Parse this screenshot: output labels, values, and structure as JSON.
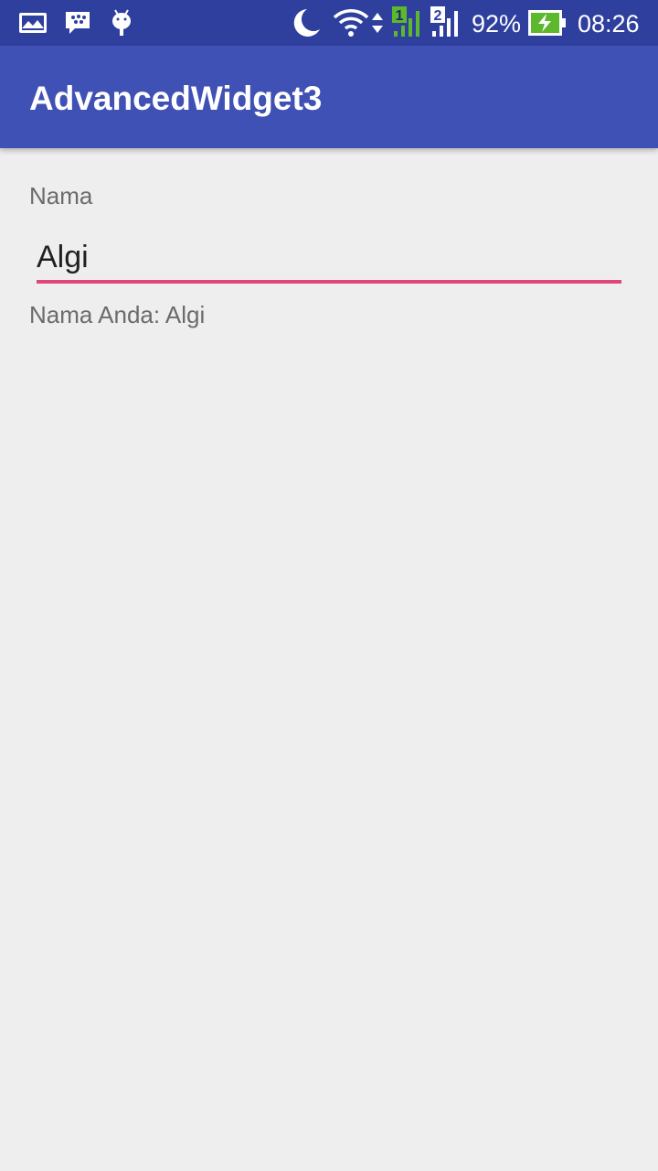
{
  "status_bar": {
    "left_icons": [
      "gallery-icon",
      "bbm-icon",
      "android-icon"
    ],
    "right_icons": [
      "moon-icon",
      "wifi-icon",
      "data-arrows-icon",
      "sim1-signal-icon",
      "sim2-signal-icon",
      "battery-charging-icon"
    ],
    "sim1_label": "1",
    "sim2_label": "2",
    "battery_percent": "92%",
    "time": "08:26"
  },
  "app_bar": {
    "title": "AdvancedWidget3"
  },
  "form": {
    "name_label": "Nama",
    "name_value": "Algi",
    "output_text": "Nama Anda: Algi"
  },
  "colors": {
    "status_bar": "#2f3f9e",
    "app_bar": "#3f51b5",
    "accent": "#e0457b",
    "background": "#eeeeee",
    "signal_green": "#5cb82c"
  }
}
